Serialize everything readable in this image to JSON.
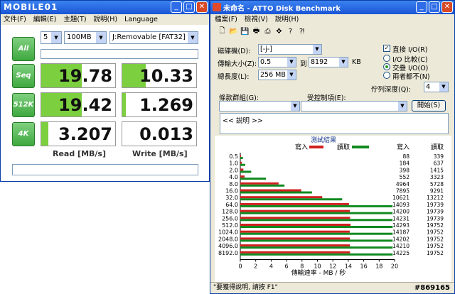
{
  "cdm": {
    "title_logo": "MOBILE01",
    "menu": [
      "文件(F)",
      "編輯(E)",
      "主題(T)",
      "說明(H)",
      "Language"
    ],
    "count_value": "5",
    "size_value": "100MB",
    "drive_value": "J:Removable [FAT32]",
    "buttons": {
      "all": "All",
      "seq": "Seq",
      "k512": "512K",
      "k4": "4K"
    },
    "read": {
      "seq": "19.78",
      "k512": "19.42",
      "k4": "3.207"
    },
    "write": {
      "seq": "10.33",
      "k512": "1.269",
      "k4": "0.013"
    },
    "read_fill": {
      "seq": 0.55,
      "k512": 0.55,
      "k4": 0.1
    },
    "write_fill": {
      "seq": 0.32,
      "k512": 0.05,
      "k4": 0.0
    },
    "read_header": "Read [MB/s]",
    "write_header": "Write [MB/s]"
  },
  "atto": {
    "title": "未命名 - ATTO Disk Benchmark",
    "menu": [
      "檔案(F)",
      "檢視(V)",
      "說明(H)"
    ],
    "drive_label": "磁碟機(D):",
    "drive_value": "[-j-]",
    "transfer_label": "傳輸大小(Z):",
    "transfer_from": "0.5",
    "to_label": "到",
    "transfer_to": "8192",
    "kb_label": "KB",
    "total_label": "總長度(L):",
    "total_value": "256 MB",
    "direct_io_label": "直接 I/O(R)",
    "io_compare_label": "I/O 比較(C)",
    "overlapped_io_label": "交疊 I/O(O)",
    "neither_label": "兩者都不(N)",
    "queue_label": "佇列深度(Q):",
    "queue_value": "4",
    "control_group_label": "條款群組(G):",
    "restriction_label": "受控制項(E):",
    "start_button": "開始(S)",
    "description": "<< 說明 >>",
    "results_title": "測試結果",
    "write_legend": "寫入",
    "read_legend": "讀取",
    "write_col": "寫入",
    "read_col": "讀取",
    "x_axis_label": "傳輸速率 - MB / 秒",
    "status": "\"要獲得說明, 請按 F1\"",
    "status_right": "NUM",
    "watermark": "#869165"
  },
  "chart_data": {
    "type": "bar",
    "title": "測試結果",
    "categories": [
      "0.5",
      "1.0",
      "2.0",
      "4.0",
      "8.0",
      "16.0",
      "32.0",
      "64.0",
      "128.0",
      "256.0",
      "512.0",
      "1024.0",
      "2048.0",
      "4096.0",
      "8192.0"
    ],
    "series": [
      {
        "name": "寫入",
        "values": [
          88,
          184,
          398,
          552,
          4964,
          7895,
          10621,
          14093,
          14200,
          14231,
          14293,
          14187,
          14202,
          14210,
          14225
        ]
      },
      {
        "name": "讀取",
        "values": [
          339,
          637,
          1415,
          3323,
          5728,
          9291,
          13212,
          19739,
          19739,
          19739,
          19752,
          19752,
          19752,
          19752,
          19752
        ]
      }
    ],
    "xlabel": "傳輸速率 - MB / 秒",
    "xlim": [
      0,
      20
    ],
    "xticks": [
      "0",
      "2",
      "4",
      "6",
      "8",
      "10",
      "12",
      "14",
      "16",
      "18",
      "20"
    ],
    "legend": "top",
    "colors": {
      "write": "#d02020",
      "read": "#108a20"
    }
  }
}
